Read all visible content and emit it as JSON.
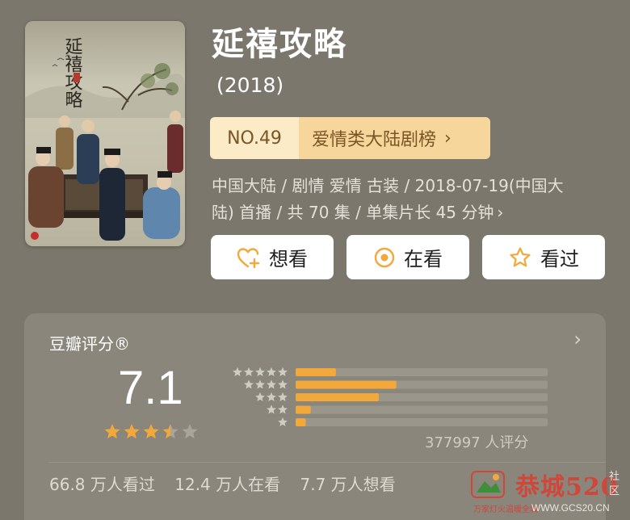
{
  "poster": {
    "title_art": "延禧攻略"
  },
  "show": {
    "title": "延禧攻略",
    "year": "(2018)"
  },
  "rank": {
    "number": "NO.49",
    "category": "爱情类大陆剧榜",
    "chevron": "›"
  },
  "meta": {
    "line1": "中国大陆 / 剧情 爱情 古装 / 2018-07-19(中国大",
    "line2": "陆) 首播 / 共 70 集 / 单集片长 45 分钟",
    "chevron": "›"
  },
  "actions": {
    "want": {
      "label": "想看",
      "icon": "heart-plus-icon"
    },
    "watching": {
      "label": "在看",
      "icon": "target-circle-icon"
    },
    "watched": {
      "label": "看过",
      "icon": "star-outline-icon"
    }
  },
  "rating": {
    "label": "豆瓣评分®",
    "arrow": "›",
    "score": "7.1",
    "star_value": 3.5,
    "star_max": 5,
    "distribution": [
      0.16,
      0.4,
      0.33,
      0.06,
      0.04
    ],
    "count": "377997 人评分",
    "colors": {
      "accent": "#f2a83a",
      "track": "#9a968b",
      "star_empty": "#a9a59b"
    }
  },
  "stats": {
    "watched": "66.8 万人看过",
    "watching": "12.4 万人在看",
    "want": "7.7 万人想看"
  },
  "watermark": {
    "text": "恭城520",
    "side": "社区",
    "small": "万家灯火温暖全城",
    "url": "WWW.GCS20.CN"
  }
}
